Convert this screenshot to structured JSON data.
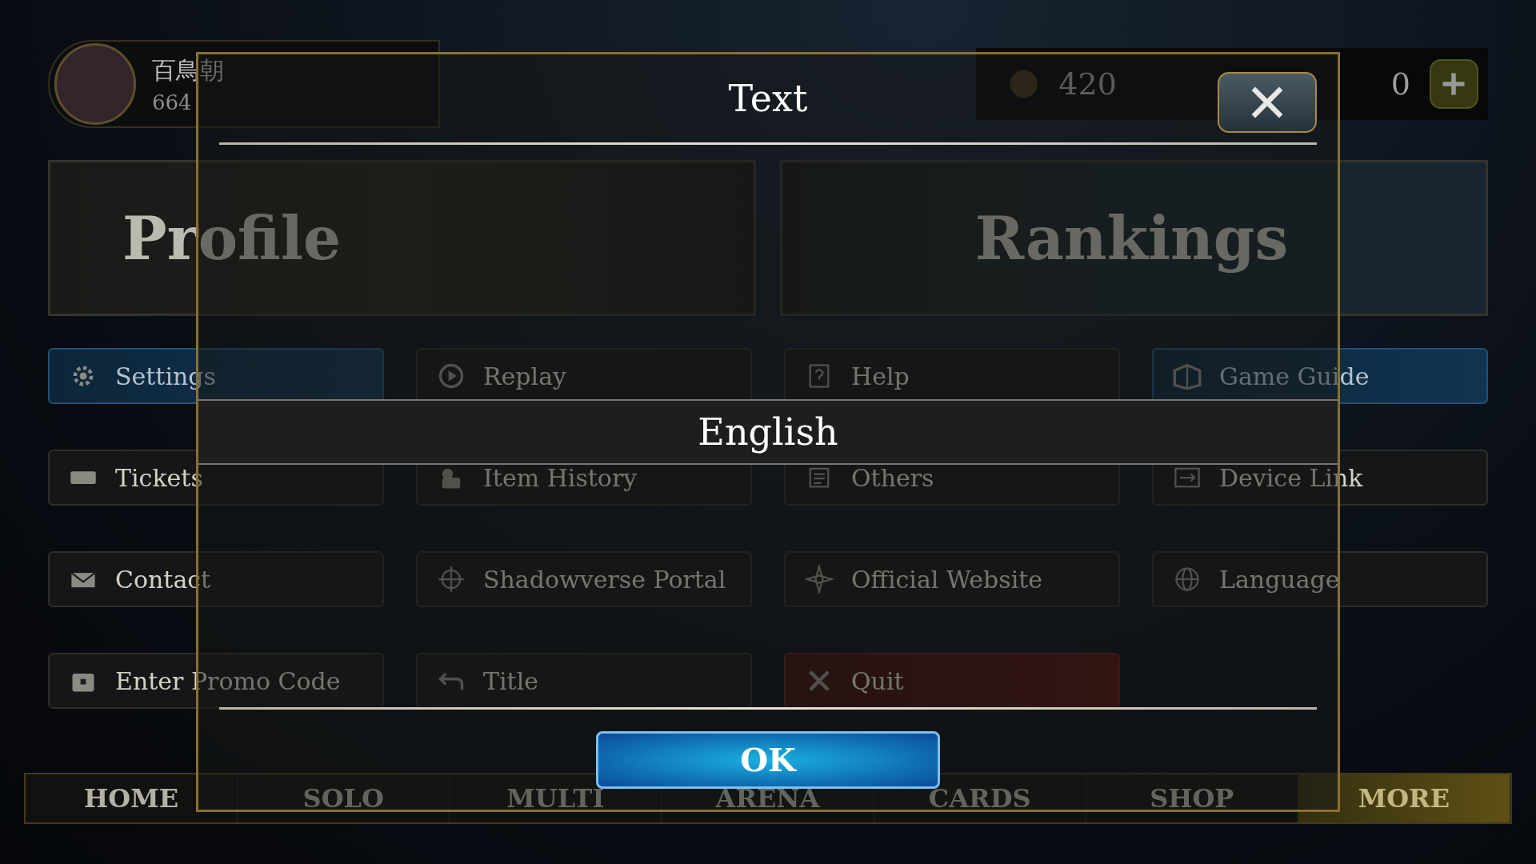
{
  "top_bar": {
    "player_name": "百鳥朝",
    "level": "664",
    "currency_a": "420",
    "currency_b": "0"
  },
  "banners": [
    {
      "label": "Profile"
    },
    {
      "label": "Rankings"
    }
  ],
  "menu": [
    {
      "label": "Settings",
      "kind": "accent"
    },
    {
      "label": "Replay",
      "kind": "plain"
    },
    {
      "label": "Help",
      "kind": "plain"
    },
    {
      "label": "Game Guide",
      "kind": "accent"
    },
    {
      "label": "Tickets",
      "kind": "plain"
    },
    {
      "label": "Item History",
      "kind": "plain"
    },
    {
      "label": "Others",
      "kind": "plain"
    },
    {
      "label": "Device Link",
      "kind": "plain"
    },
    {
      "label": "Contact",
      "kind": "plain"
    },
    {
      "label": "Shadowverse Portal",
      "kind": "plain"
    },
    {
      "label": "Official Website",
      "kind": "plain"
    },
    {
      "label": "Language",
      "kind": "plain"
    },
    {
      "label": "Enter Promo Code",
      "kind": "plain"
    },
    {
      "label": "Title",
      "kind": "plain"
    },
    {
      "label": "Quit",
      "kind": "danger"
    }
  ],
  "nav": [
    {
      "label": "HOME",
      "selected": false
    },
    {
      "label": "SOLO",
      "selected": false
    },
    {
      "label": "MULTI",
      "selected": false
    },
    {
      "label": "ARENA",
      "selected": false
    },
    {
      "label": "CARDS",
      "selected": false
    },
    {
      "label": "SHOP",
      "selected": false
    },
    {
      "label": "MORE",
      "selected": true
    }
  ],
  "dialog": {
    "title": "Text",
    "options": [
      {
        "label": "English",
        "selected": true
      }
    ],
    "ok_button": "OK"
  }
}
